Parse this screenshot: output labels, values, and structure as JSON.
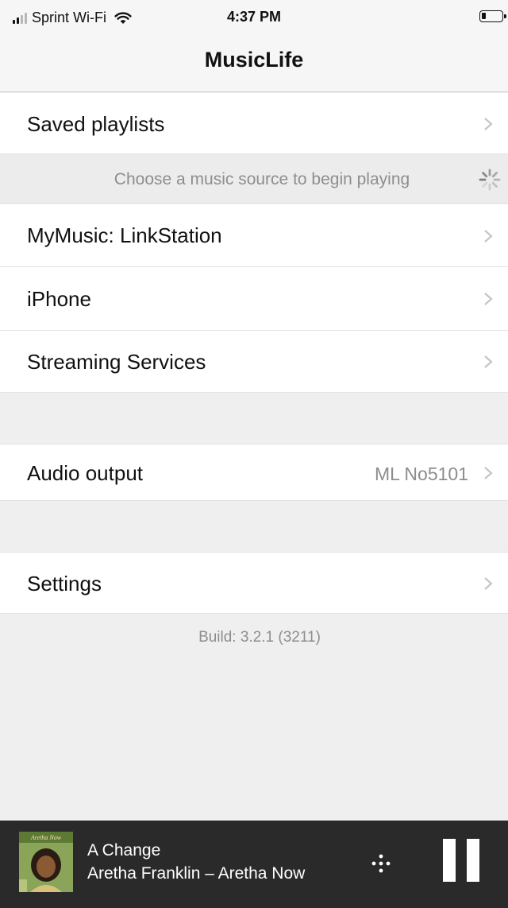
{
  "status_bar": {
    "carrier": "Sprint Wi-Fi",
    "time": "4:37 PM"
  },
  "nav": {
    "title": "MusicLife"
  },
  "menu": {
    "saved_playlists": "Saved playlists",
    "hint": "Choose a music source to begin playing",
    "sources": [
      "MyMusic: LinkStation",
      "iPhone",
      "Streaming Services"
    ],
    "audio_output_label": "Audio output",
    "audio_output_value": "ML No5101",
    "settings": "Settings"
  },
  "build": "Build: 3.2.1 (3211)",
  "now_playing": {
    "album_art_text": "Aretha Now",
    "title": "A Change",
    "subtitle": "Aretha Franklin – Aretha Now"
  },
  "icons": {
    "chevron": "chevron-right-icon",
    "spinner": "activity-spinner-icon",
    "queue": "queue-dots-icon",
    "pause": "pause-icon",
    "wifi": "wifi-icon",
    "battery": "battery-icon",
    "signal": "signal-strength-icon"
  },
  "colors": {
    "background": "#efefef",
    "row_background": "#ffffff",
    "secondary_text": "#8e8e8e",
    "player_background": "#2a2a2a"
  }
}
